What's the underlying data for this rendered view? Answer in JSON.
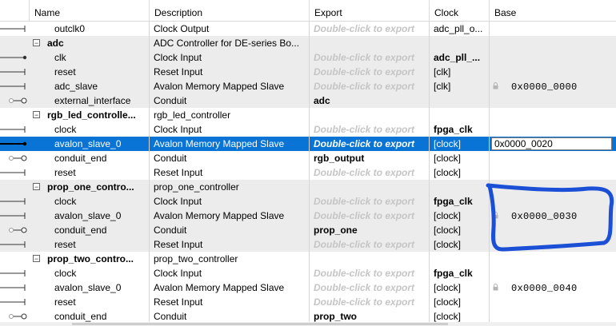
{
  "columns": {
    "name": "Name",
    "description": "Description",
    "export": "Export",
    "clock": "Clock",
    "base": "Base"
  },
  "export_placeholder": "Double-click to export",
  "rows": [
    {
      "kind": "port",
      "conn": "line",
      "name": "outclk0",
      "desc": "Clock Output",
      "export": "",
      "clock": "adc_pll_o...",
      "clock_bold": false,
      "base": "",
      "bg": "white"
    },
    {
      "kind": "group",
      "conn": "none",
      "name": "adc",
      "desc": "ADC Controller for DE-series Bo...",
      "export": null,
      "clock": "",
      "base": "",
      "bg": "gray"
    },
    {
      "kind": "port",
      "conn": "arrow",
      "name": "clk",
      "desc": "Clock Input",
      "export": "",
      "clock": "adc_pll_...",
      "clock_bold": true,
      "base": "",
      "bg": "gray"
    },
    {
      "kind": "port",
      "conn": "line",
      "name": "reset",
      "desc": "Reset Input",
      "export": "",
      "clock": "[clk]",
      "clock_bold": false,
      "base": "",
      "bg": "gray"
    },
    {
      "kind": "port",
      "conn": "line",
      "name": "adc_slave",
      "desc": "Avalon Memory Mapped Slave",
      "export": "",
      "clock": "[clk]",
      "clock_bold": false,
      "base": "0x0000_0000",
      "base_lock": true,
      "bg": "gray"
    },
    {
      "kind": "port",
      "conn": "conduit",
      "name": "external_interface",
      "desc": "Conduit",
      "export": "adc",
      "clock": "",
      "clock_bold": false,
      "base": "",
      "bg": "gray"
    },
    {
      "kind": "group",
      "conn": "none",
      "name": "rgb_led_controlle...",
      "desc": "rgb_led_controller",
      "export": null,
      "clock": "",
      "base": "",
      "bg": "white"
    },
    {
      "kind": "port",
      "conn": "line",
      "name": "clock",
      "desc": "Clock Input",
      "export": "",
      "clock": "fpga_clk",
      "clock_bold": true,
      "base": "",
      "bg": "white"
    },
    {
      "kind": "port",
      "conn": "arrow",
      "name": "avalon_slave_0",
      "desc": "Avalon Memory Mapped Slave",
      "export": "",
      "clock": "[clock]",
      "clock_bold": false,
      "base": "0x0000_0020",
      "base_edit": true,
      "bg": "selected"
    },
    {
      "kind": "port",
      "conn": "conduit",
      "name": "conduit_end",
      "desc": "Conduit",
      "export": "rgb_output",
      "clock": "[clock]",
      "clock_bold": false,
      "base": "",
      "bg": "white"
    },
    {
      "kind": "port",
      "conn": "line",
      "name": "reset",
      "desc": "Reset Input",
      "export": "",
      "clock": "[clock]",
      "clock_bold": false,
      "base": "",
      "bg": "white"
    },
    {
      "kind": "group",
      "conn": "none",
      "name": "prop_one_contro...",
      "desc": "prop_one_controller",
      "export": null,
      "clock": "",
      "base": "",
      "bg": "gray"
    },
    {
      "kind": "port",
      "conn": "line",
      "name": "clock",
      "desc": "Clock Input",
      "export": "",
      "clock": "fpga_clk",
      "clock_bold": true,
      "base": "",
      "bg": "gray"
    },
    {
      "kind": "port",
      "conn": "line",
      "name": "avalon_slave_0",
      "desc": "Avalon Memory Mapped Slave",
      "export": "",
      "clock": "[clock]",
      "clock_bold": false,
      "base": "0x0000_0030",
      "base_lock": true,
      "bg": "gray"
    },
    {
      "kind": "port",
      "conn": "conduit",
      "name": "conduit_end",
      "desc": "Conduit",
      "export": "prop_one",
      "clock": "[clock]",
      "clock_bold": false,
      "base": "",
      "bg": "gray"
    },
    {
      "kind": "port",
      "conn": "line",
      "name": "reset",
      "desc": "Reset Input",
      "export": "",
      "clock": "[clock]",
      "clock_bold": false,
      "base": "",
      "bg": "gray"
    },
    {
      "kind": "group",
      "conn": "none",
      "name": "prop_two_contro...",
      "desc": "prop_two_controller",
      "export": null,
      "clock": "",
      "base": "",
      "bg": "white"
    },
    {
      "kind": "port",
      "conn": "line",
      "name": "clock",
      "desc": "Clock Input",
      "export": "",
      "clock": "fpga_clk",
      "clock_bold": true,
      "base": "",
      "bg": "white"
    },
    {
      "kind": "port",
      "conn": "line",
      "name": "avalon_slave_0",
      "desc": "Avalon Memory Mapped Slave",
      "export": "",
      "clock": "[clock]",
      "clock_bold": false,
      "base": "0x0000_0040",
      "base_lock": true,
      "bg": "white"
    },
    {
      "kind": "port",
      "conn": "line",
      "name": "reset",
      "desc": "Reset Input",
      "export": "",
      "clock": "[clock]",
      "clock_bold": false,
      "base": "",
      "bg": "white"
    },
    {
      "kind": "port",
      "conn": "conduit",
      "name": "conduit_end",
      "desc": "Conduit",
      "export": "prop_two",
      "clock": "[clock]",
      "clock_bold": false,
      "base": "",
      "bg": "white"
    }
  ],
  "colors": {
    "selection": "#0a74d6",
    "annotation": "#1a4fd6",
    "placeholder": "#c5c5c5",
    "group_bg": "#ececec"
  }
}
